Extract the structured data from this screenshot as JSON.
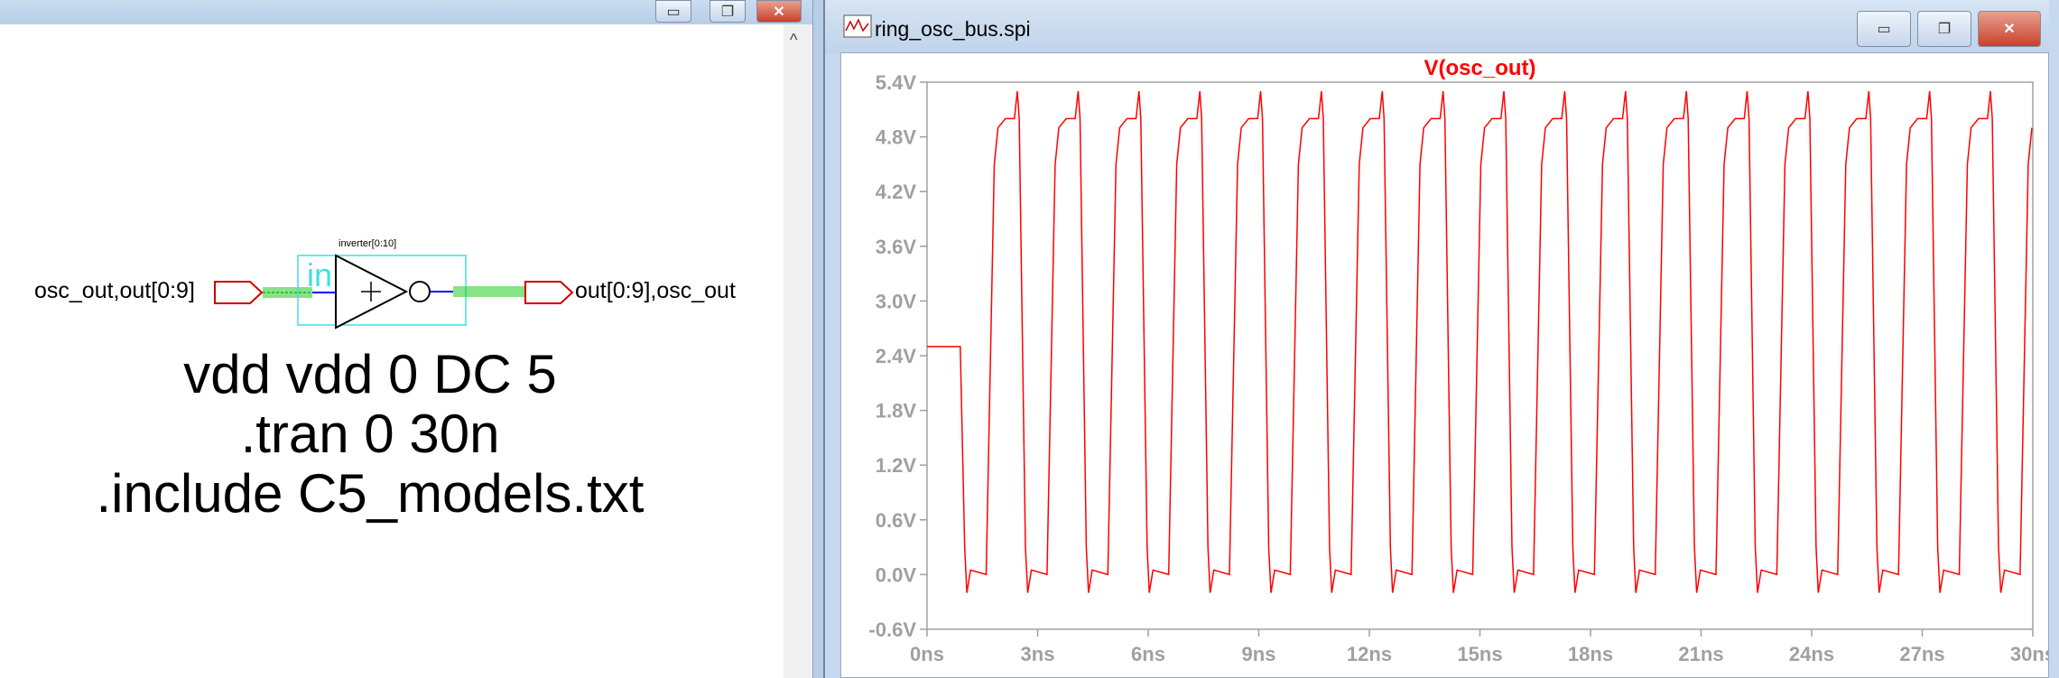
{
  "schematic": {
    "window_buttons": [
      "▭",
      "❐",
      "✕"
    ],
    "scroll_up": "^",
    "input_label": "osc_out,out[0:9]",
    "output_label": "out[0:9],osc_out",
    "instance_name": "inverter[0:10]",
    "symbol_text": "in",
    "directives": [
      "vdd vdd 0 DC 5",
      ".tran 0 30n",
      ".include C5_models.txt"
    ]
  },
  "plot_window": {
    "title": "ring_osc_bus.spi",
    "window_buttons": [
      "▭",
      "❐",
      "✕"
    ]
  },
  "chart_data": {
    "type": "line",
    "title": "",
    "trace_label": "V(osc_out)",
    "xlabel": "",
    "ylabel": "",
    "xlim": [
      0,
      30
    ],
    "ylim": [
      -0.6,
      5.4
    ],
    "x_ticks": [
      "0ns",
      "3ns",
      "6ns",
      "9ns",
      "12ns",
      "15ns",
      "18ns",
      "21ns",
      "24ns",
      "27ns",
      "30ns"
    ],
    "y_ticks": [
      "5.4V",
      "4.8V",
      "4.2V",
      "3.6V",
      "3.0V",
      "2.4V",
      "1.8V",
      "1.2V",
      "0.6V",
      "0.0V",
      "-0.6V"
    ],
    "x_unit": "ns",
    "y_unit": "V",
    "initial_value": 2.5,
    "first_fall_ns": 0.9,
    "period_ns": 1.65,
    "high_level": 5.0,
    "low_level": 0.0,
    "overshoot_peak": 5.3,
    "undershoot_peak": -0.2,
    "series": [
      {
        "name": "V(osc_out)",
        "color": "#ff0000"
      }
    ],
    "grid": false
  },
  "colors": {
    "trace": "#ff0000",
    "axis_tick_labels": "#a0a0a0",
    "bus_hatch": "#22cc22",
    "symbol_box": "#40e0e0",
    "port_flag": "#cc0000",
    "wire": "#0000ff"
  }
}
